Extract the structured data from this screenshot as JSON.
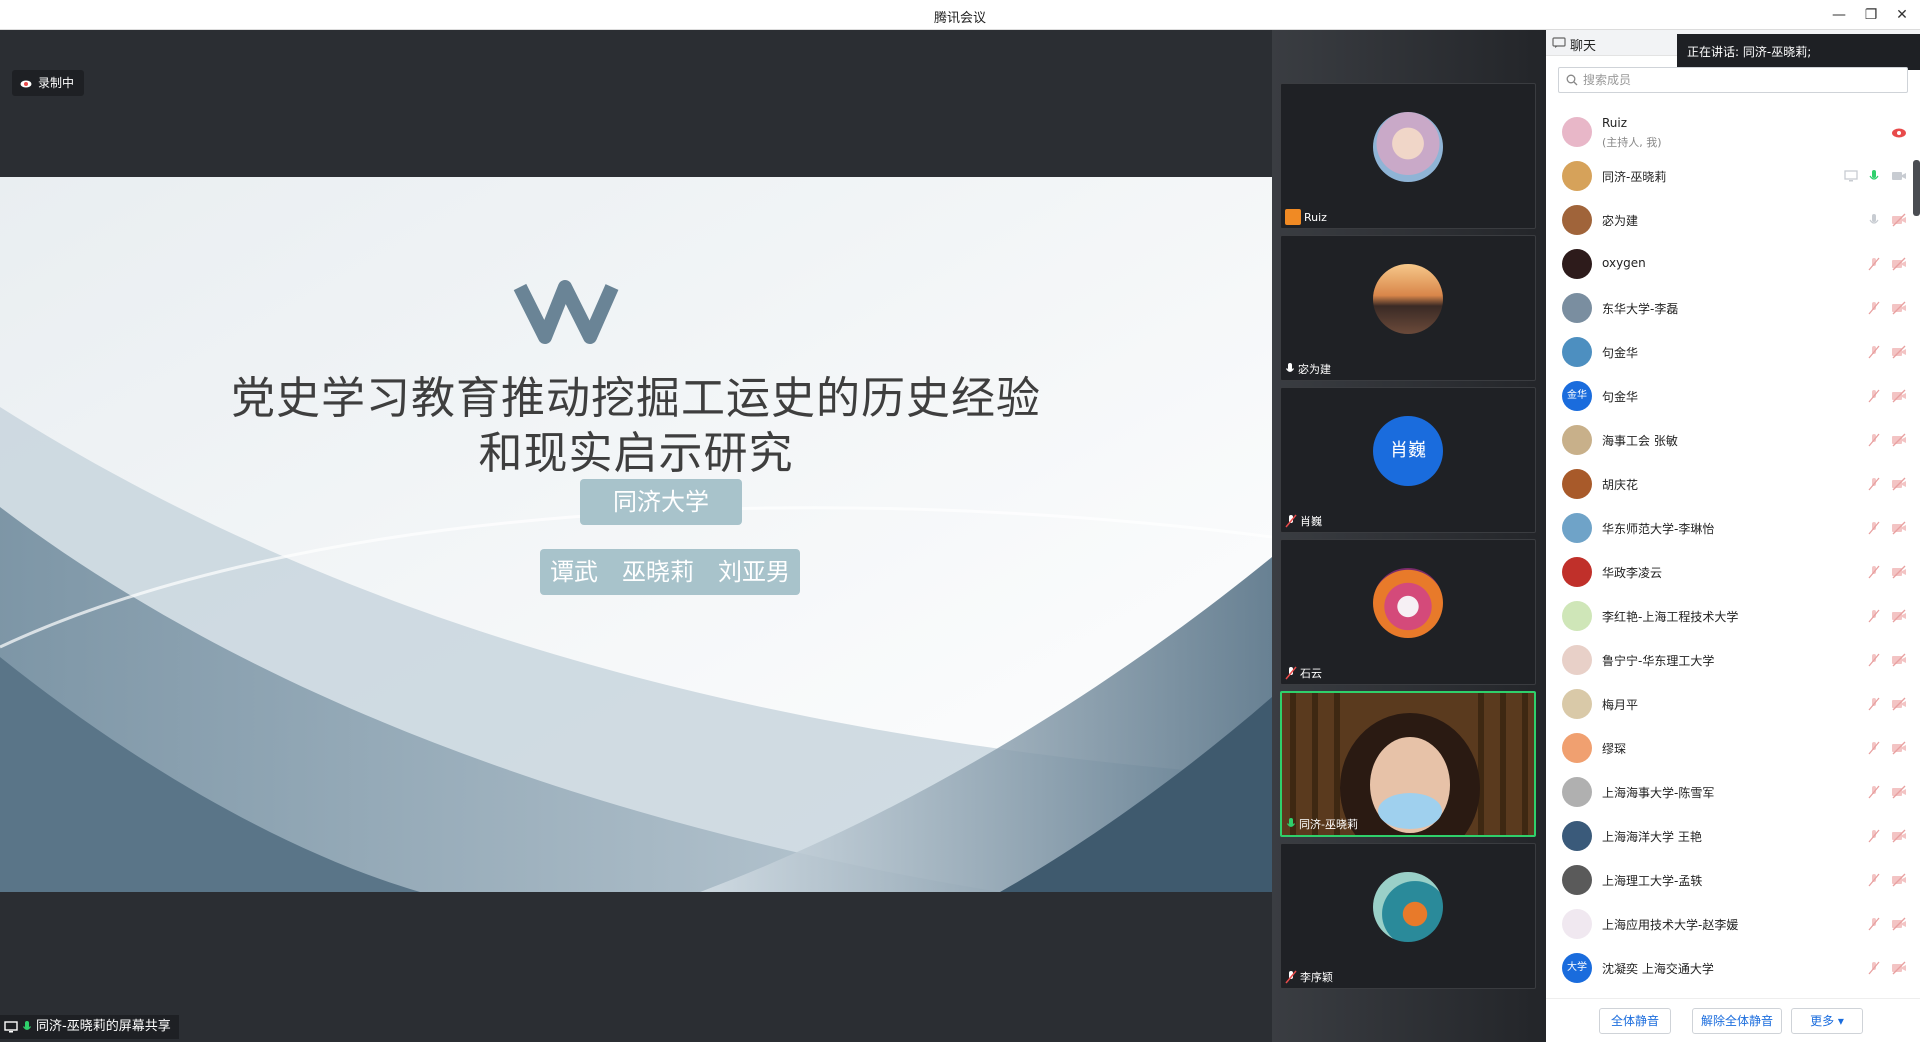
{
  "window": {
    "title": "腾讯会议"
  },
  "share": {
    "recording_label": "录制中",
    "sharer_label": "同济-巫晓莉的屏幕共享"
  },
  "slide": {
    "title_line1": "党史学习教育推动挖掘工运史的历史经验",
    "title_line2": "和现实启示研究",
    "school": "同济大学",
    "authors": "谭武　巫晓莉　刘亚男"
  },
  "video_tiles": [
    {
      "name": "Ruiz",
      "icon": "host-icon"
    },
    {
      "name": "宓为建",
      "icon": "mic-icon"
    },
    {
      "name": "肖巍",
      "icon": "mic-muted-icon",
      "avatar_text": "肖巍"
    },
    {
      "name": "石云",
      "icon": "mic-muted-icon"
    },
    {
      "name": "同济-巫晓莉",
      "icon": "mic-active-icon"
    },
    {
      "name": "李序颖",
      "icon": "mic-muted-icon"
    }
  ],
  "panel": {
    "tab_chat": "聊天",
    "speaking": "正在讲话: 同济-巫晓莉;",
    "search_placeholder": "搜索成员",
    "participants": [
      {
        "name": "Ruiz",
        "sub": "(主持人, 我)",
        "color": "#e8b7c8"
      },
      {
        "name": "同济-巫晓莉",
        "color": "#d6a25a"
      },
      {
        "name": "宓为建",
        "color": "#a0643a"
      },
      {
        "name": "oxygen",
        "color": "#2d1b1b"
      },
      {
        "name": "东华大学-李磊",
        "color": "#7a8ea0"
      },
      {
        "name": "句金华",
        "color": "#4d8fc0"
      },
      {
        "name": "句金华",
        "color": "#1a6cdd",
        "avatar_text": "金华"
      },
      {
        "name": "海事工会 张敏",
        "color": "#c8b08a"
      },
      {
        "name": "胡庆花",
        "color": "#a85a2a"
      },
      {
        "name": "华东师范大学-李琳怡",
        "color": "#6fa3c8"
      },
      {
        "name": "华政李凌云",
        "color": "#c0302a"
      },
      {
        "name": "李红艳-上海工程技术大学",
        "color": "#cfe6b8"
      },
      {
        "name": "鲁宁宁-华东理工大学",
        "color": "#e8d0c8"
      },
      {
        "name": "梅月平",
        "color": "#d9c9a8"
      },
      {
        "name": "缪琛",
        "color": "#f0a070"
      },
      {
        "name": "上海海事大学-陈雪军",
        "color": "#b0b0b0"
      },
      {
        "name": "上海海洋大学 王艳",
        "color": "#3a5a7a"
      },
      {
        "name": "上海理工大学-孟轶",
        "color": "#5a5a5a"
      },
      {
        "name": "上海应用技术大学-赵李媛",
        "color": "#f0e8f0"
      },
      {
        "name": "沈凝奕 上海交通大学",
        "color": "#1a6cdd",
        "avatar_text": "大学"
      }
    ],
    "btn_mute_all": "全体静音",
    "btn_unmute_all": "解除全体静音",
    "btn_more": "更多 ▾"
  }
}
